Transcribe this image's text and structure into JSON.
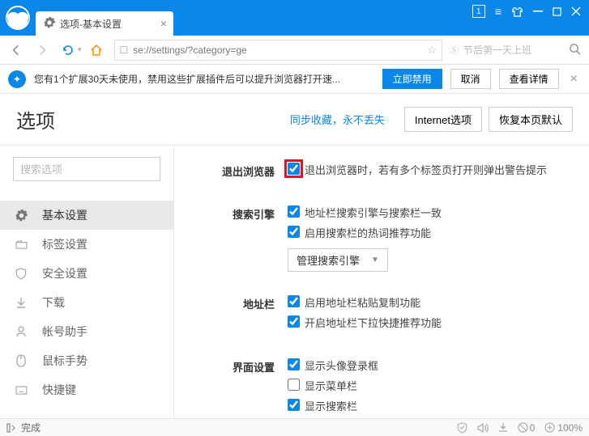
{
  "titlebar": {
    "tab_title": "选项-基本设置",
    "window_count": "1"
  },
  "navbar": {
    "url": "se://settings/?category=ge",
    "hint": "节后第一天上班"
  },
  "banner": {
    "text": "您有1个扩展30天未使用，禁用这些扩展插件后可以提升浏览器打开速...",
    "disable_btn": "立即禁用",
    "cancel_btn": "取消",
    "detail_btn": "查看详情"
  },
  "header": {
    "title": "选项",
    "sync_link": "同步收藏，永不丢失",
    "internet_btn": "Internet选项",
    "restore_btn": "恢复本页默认"
  },
  "sidebar": {
    "search_placeholder": "搜索选项",
    "items": [
      {
        "label": "基本设置"
      },
      {
        "label": "标签设置"
      },
      {
        "label": "安全设置"
      },
      {
        "label": "下载"
      },
      {
        "label": "帐号助手"
      },
      {
        "label": "鼠标手势"
      },
      {
        "label": "快捷键"
      }
    ]
  },
  "content": {
    "exit": {
      "label": "退出浏览器",
      "opt1": "退出浏览器时，若有多个标签页打开则弹出警告提示"
    },
    "search": {
      "label": "搜索引擎",
      "opt1": "地址栏搜索引擎与搜索栏一致",
      "opt2": "启用搜索栏的热词推荐功能",
      "manage_btn": "管理搜索引擎"
    },
    "address": {
      "label": "地址栏",
      "opt1": "启用地址栏粘贴复制功能",
      "opt2": "开启地址栏下拉快捷推荐功能"
    },
    "ui": {
      "label": "界面设置",
      "opt1": "显示头像登录框",
      "opt2": "显示菜单栏",
      "opt3": "显示搜索栏"
    }
  },
  "statusbar": {
    "status": "完成",
    "zoom_badge": "0",
    "zoom": "100%"
  }
}
